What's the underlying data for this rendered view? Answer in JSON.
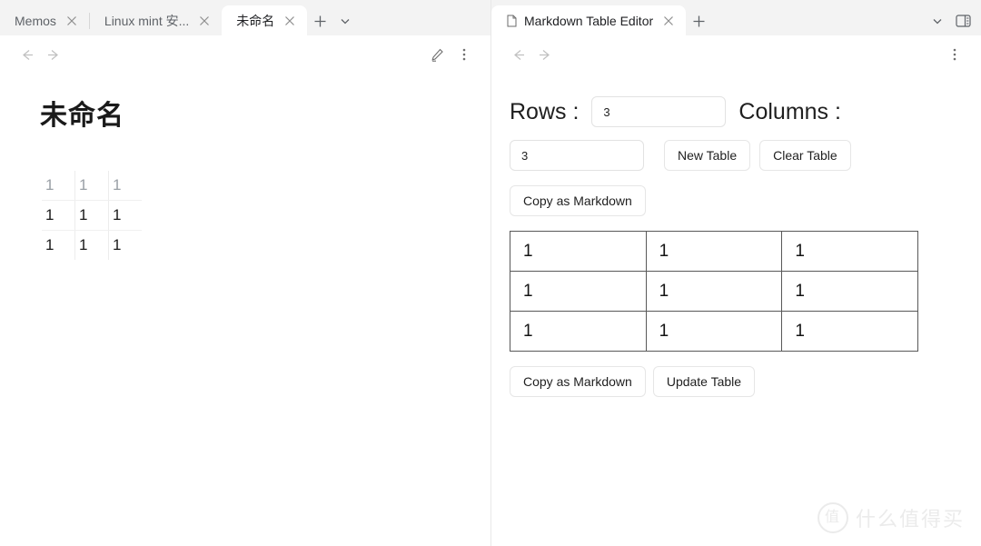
{
  "left_panel": {
    "tabs": [
      {
        "label": "Memos",
        "active": false,
        "close_icon": "close-icon"
      },
      {
        "label": "Linux mint 安...",
        "active": false,
        "close_icon": "close-icon"
      },
      {
        "label": "未命名",
        "active": true,
        "close_icon": "close-icon"
      }
    ],
    "new_tab_label": "+",
    "tablist_chevron": "chevron-down-icon",
    "toolbar": {
      "back": "back-arrow-icon",
      "forward": "forward-arrow-icon",
      "edit": "pencil-icon",
      "more": "more-vertical-icon"
    },
    "document": {
      "title": "未命名",
      "table": {
        "rows": [
          [
            "1",
            "1",
            "1"
          ],
          [
            "1",
            "1",
            "1"
          ],
          [
            "1",
            "1",
            "1"
          ]
        ]
      }
    }
  },
  "right_panel": {
    "tabs": [
      {
        "label": "Markdown Table Editor",
        "active": true,
        "doc_icon": "document-icon",
        "close_icon": "close-icon"
      }
    ],
    "new_tab_label": "+",
    "tablist_chevron": "chevron-down-icon",
    "panel_toggle": "split-panel-icon",
    "toolbar": {
      "back": "back-arrow-icon",
      "forward": "forward-arrow-icon",
      "more": "more-vertical-icon"
    },
    "editor": {
      "rows_label": "Rows :",
      "rows_value": "3",
      "columns_label": "Columns :",
      "columns_value": "3",
      "new_table_label": "New Table",
      "clear_table_label": "Clear Table",
      "copy_markdown_top_label": "Copy as Markdown",
      "copy_markdown_bottom_label": "Copy as Markdown",
      "update_table_label": "Update Table",
      "table": {
        "rows": [
          [
            "1",
            "1",
            "1"
          ],
          [
            "1",
            "1",
            "1"
          ],
          [
            "1",
            "1",
            "1"
          ]
        ]
      }
    }
  },
  "watermark": {
    "badge_text": "值",
    "text": "什么值得买"
  },
  "colors": {
    "tabstrip_bg": "#f3f3f3",
    "page_bg": "#ffffff",
    "table_border": "#585858",
    "muted_text": "#9aa0a6"
  }
}
